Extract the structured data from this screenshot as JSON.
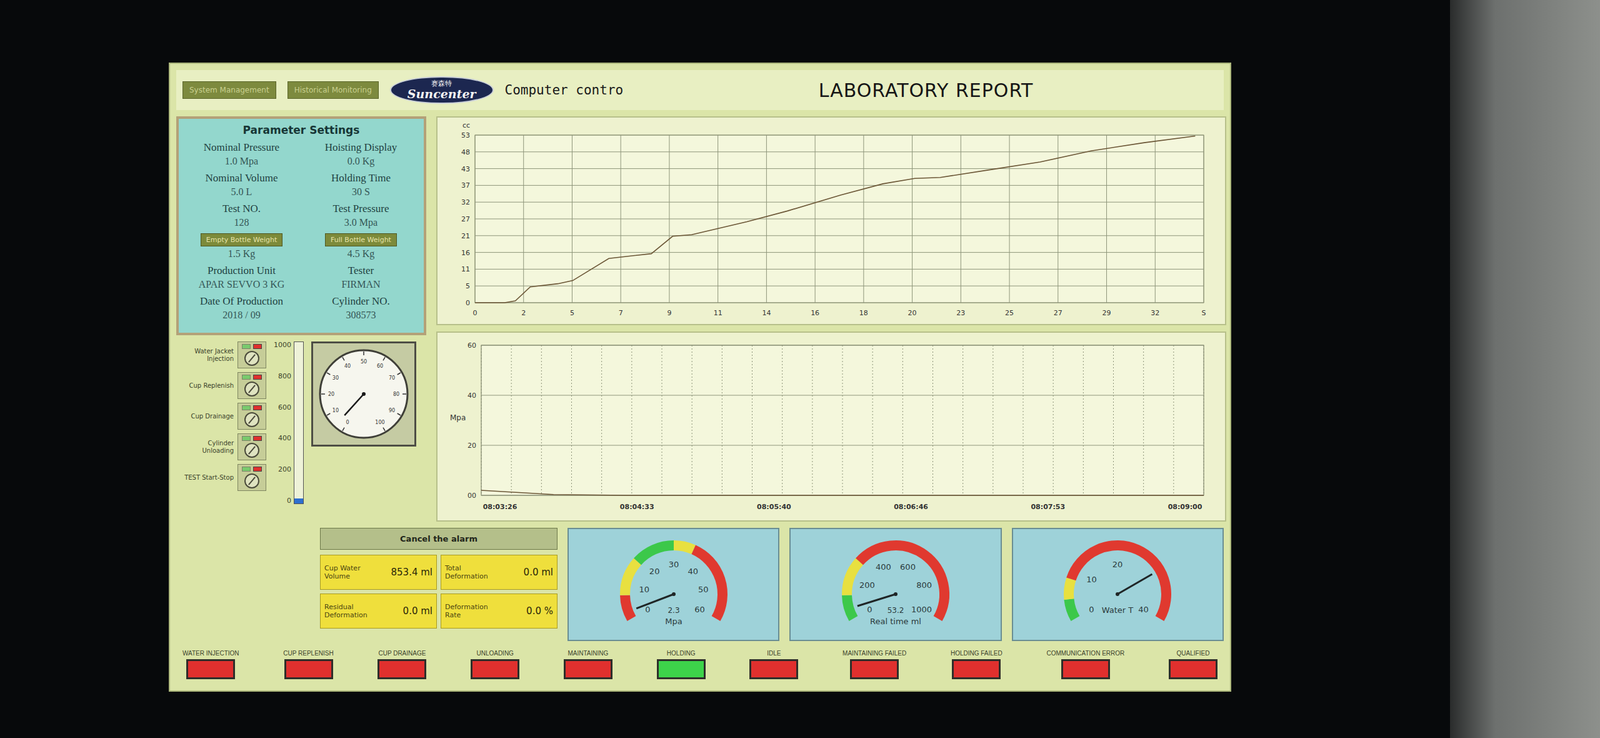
{
  "header": {
    "nav_buttons": [
      {
        "label": "System Management"
      },
      {
        "label": "Historical Monitoring"
      }
    ],
    "logo": {
      "chinese": "赛森特",
      "brand": "Suncenter"
    },
    "subtitle": "Computer contro",
    "title": "LABORATORY REPORT"
  },
  "parameters": {
    "title": "Parameter Settings",
    "fields": [
      {
        "label": "Nominal Pressure",
        "value": "1.0 Mpa",
        "kind": "text"
      },
      {
        "label": "Hoisting Display",
        "value": "0.0 Kg",
        "kind": "text"
      },
      {
        "label": "Nominal Volume",
        "value": "5.0 L",
        "kind": "text"
      },
      {
        "label": "Holding Time",
        "value": "30 S",
        "kind": "text"
      },
      {
        "label": "Test NO.",
        "value": "128",
        "kind": "text"
      },
      {
        "label": "Test Pressure",
        "value": "3.0 Mpa",
        "kind": "text"
      },
      {
        "label": "Empty Bottle Weight",
        "value": "1.5 Kg",
        "kind": "button"
      },
      {
        "label": "Full Bottle Weight",
        "value": "4.5 Kg",
        "kind": "button"
      },
      {
        "label": "Production Unit",
        "value": "APAR SEVVO 3 KG",
        "kind": "text"
      },
      {
        "label": "Tester",
        "value": "FIRMAN",
        "kind": "text"
      },
      {
        "label": "Date Of Production",
        "value": "2018 / 09",
        "kind": "text"
      },
      {
        "label": "Cylinder NO.",
        "value": "308573",
        "kind": "text"
      }
    ]
  },
  "volume_chart": {
    "unit": "cc",
    "y_min": 0,
    "y_max": 53,
    "x_min": 0,
    "x_max": 34.3,
    "y_ticks": [
      "0",
      "5",
      "11",
      "16",
      "21",
      "27",
      "32",
      "37",
      "43",
      "48",
      "53"
    ],
    "x_ticks": [
      "0",
      "2",
      "5",
      "7",
      "9",
      "11",
      "14",
      "16",
      "18",
      "20",
      "23",
      "25",
      "27",
      "29",
      "32",
      "S"
    ],
    "series": [
      {
        "name": "volume",
        "times": [
          0,
          1.4,
          1.9,
          2.6,
          3.9,
          4.6,
          6.3,
          8.3,
          9.3,
          10.2,
          12.8,
          14.7,
          17.2,
          19.2,
          20.7,
          21.9,
          24.2,
          26.6,
          29,
          31.5,
          33.9
        ],
        "values": [
          0,
          0,
          0.6,
          5,
          6,
          7,
          14,
          15.5,
          21,
          21.5,
          25.6,
          29,
          34,
          37.6,
          39.3,
          39.6,
          42,
          44.5,
          48,
          50.6,
          52.7
        ]
      }
    ]
  },
  "pressure_chart": {
    "unit": "Mpa",
    "y_min": 0,
    "y_max": 60,
    "y_ticks": [
      "00",
      "20",
      "40",
      "60"
    ],
    "x_ticks": [
      "08:03:26",
      "08:04:33",
      "08:05:40",
      "08:06:46",
      "08:07:53",
      "08:09:00"
    ],
    "series": [
      {
        "name": "pressure",
        "values": [
          2,
          0.3,
          0,
          0,
          0,
          0,
          0,
          0,
          0,
          0,
          0
        ]
      }
    ]
  },
  "switches": [
    {
      "label": "Water Jacket Injection",
      "on": false
    },
    {
      "label": "Cup Replenish",
      "on": false
    },
    {
      "label": "Cup Drainage",
      "on": false
    },
    {
      "label": "Cylinder Unloading",
      "on": false
    },
    {
      "label": "TEST Start-Stop",
      "on": false
    }
  ],
  "level_bar": {
    "ticks": [
      "1000",
      "800",
      "600",
      "400",
      "200",
      "0"
    ],
    "level": 0.03
  },
  "dial": {
    "labels": [
      "0",
      "10",
      "20",
      "30",
      "40",
      "50",
      "60",
      "70",
      "80",
      "90",
      "100"
    ],
    "level": 0.04
  },
  "alarm_button": {
    "label": "Cancel the alarm"
  },
  "readouts": [
    {
      "label": "Cup Water Volume",
      "value": "853.4 ml"
    },
    {
      "label": "Total Deformation",
      "value": "0.0 ml"
    },
    {
      "label": "Residual Deformation",
      "value": "0.0 ml"
    },
    {
      "label": "Deformation Rate",
      "value": "0.0 %"
    }
  ],
  "gauges": [
    {
      "name": "pressure",
      "reading": "2.3",
      "unit": "Mpa",
      "level": 0.038,
      "ticks": [
        {
          "label": "0",
          "at": 0
        },
        {
          "label": "10",
          "at": 0.1667
        },
        {
          "label": "20",
          "at": 0.3333
        },
        {
          "label": "30",
          "at": 0.5
        },
        {
          "label": "40",
          "at": 0.6667
        },
        {
          "label": "50",
          "at": 0.8333
        },
        {
          "label": "60",
          "at": 1
        }
      ],
      "bands": [
        {
          "from": 0,
          "to": 0.12,
          "color": "#e0392f"
        },
        {
          "from": 0.12,
          "to": 0.3,
          "color": "#e8e040"
        },
        {
          "from": 0.3,
          "to": 0.5,
          "color": "#3cc84a"
        },
        {
          "from": 0.5,
          "to": 0.6,
          "color": "#e8e040"
        },
        {
          "from": 0.6,
          "to": 1,
          "color": "#e0392f"
        }
      ]
    },
    {
      "name": "real-time-volume",
      "reading": "53.2",
      "unit": "Real time ml",
      "level": 0.053,
      "ticks": [
        {
          "label": "0",
          "at": 0
        },
        {
          "label": "200",
          "at": 0.2
        },
        {
          "label": "400",
          "at": 0.4
        },
        {
          "label": "600",
          "at": 0.6
        },
        {
          "label": "800",
          "at": 0.8
        },
        {
          "label": "1000",
          "at": 1
        }
      ],
      "bands": [
        {
          "from": 0,
          "to": 0.12,
          "color": "#3cc84a"
        },
        {
          "from": 0.12,
          "to": 0.3,
          "color": "#e8e040"
        },
        {
          "from": 0.3,
          "to": 1,
          "color": "#e0392f"
        }
      ]
    },
    {
      "name": "water-temperature",
      "unit": "Water T",
      "level": 0.75,
      "ticks": [
        {
          "label": "0",
          "at": 0
        },
        {
          "label": "10",
          "at": 0.25
        },
        {
          "label": "20",
          "at": 0.5
        },
        {
          "label": "40",
          "at": 1
        }
      ],
      "bands": [
        {
          "from": 0,
          "to": 0.1,
          "color": "#3cc84a"
        },
        {
          "from": 0.1,
          "to": 0.2,
          "color": "#e8e040"
        },
        {
          "from": 0.2,
          "to": 1,
          "color": "#e0392f"
        }
      ]
    }
  ],
  "status_lamps": [
    {
      "label": "WATER INJECTION",
      "on": false
    },
    {
      "label": "CUP REPLENISH",
      "on": false
    },
    {
      "label": "CUP DRAINAGE",
      "on": false
    },
    {
      "label": "UNLOADING",
      "on": false
    },
    {
      "label": "MAINTAINING",
      "on": false
    },
    {
      "label": "HOLDING",
      "on": true
    },
    {
      "label": "IDLE",
      "on": false
    },
    {
      "label": "MAINTAINING FAILED",
      "on": false
    },
    {
      "label": "HOLDING FAILED",
      "on": false
    },
    {
      "label": "COMMUNICATION ERROR",
      "on": false
    },
    {
      "label": "QUALIFIED",
      "on": false
    }
  ]
}
